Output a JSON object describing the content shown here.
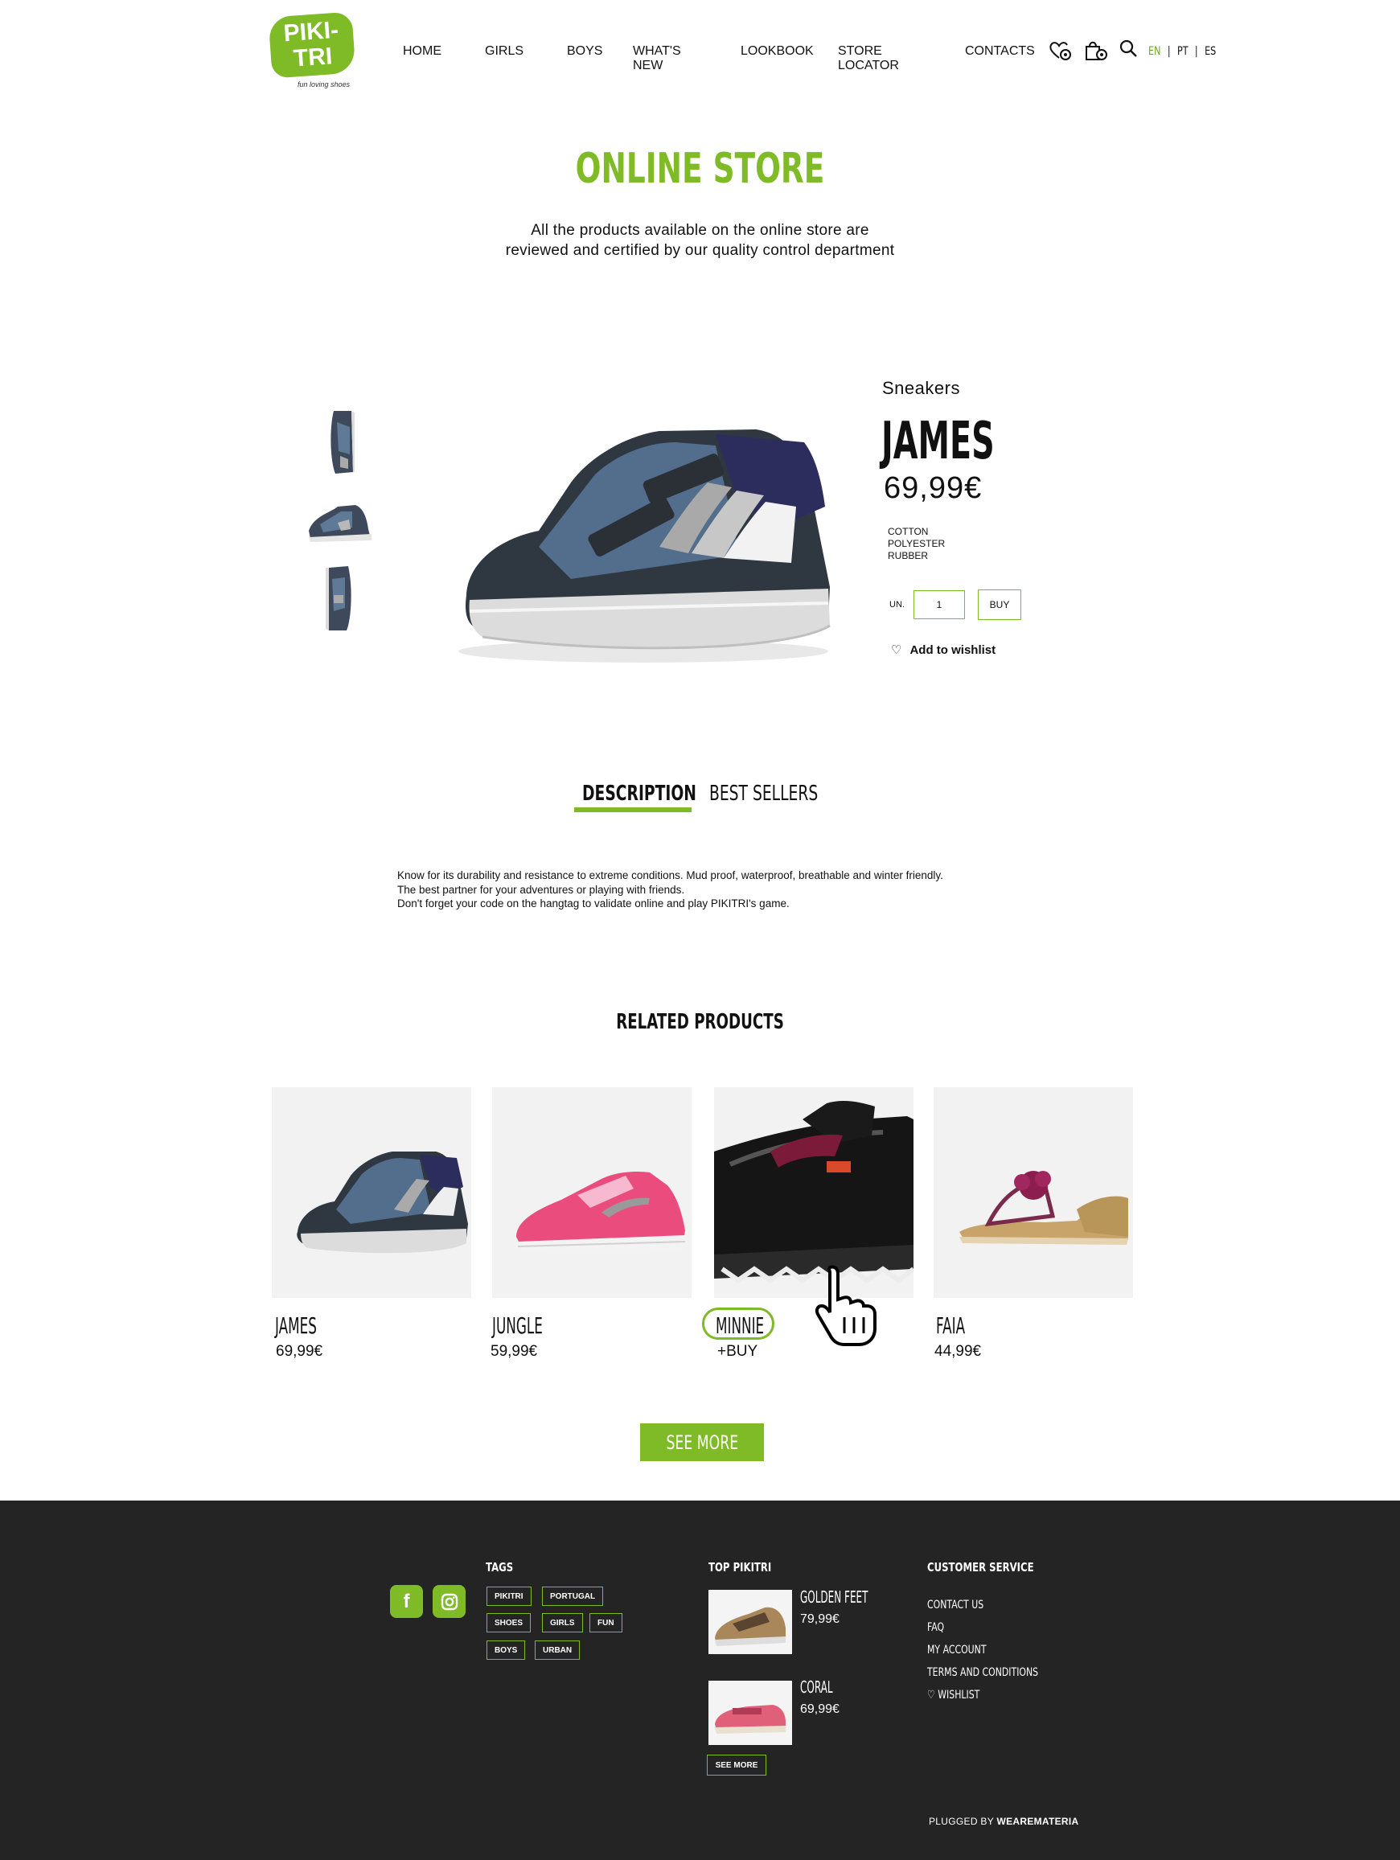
{
  "header": {
    "logo_text": "PIKI-TRI",
    "logo_tagline": "fun loving shoes",
    "nav": [
      "HOME",
      "GIRLS",
      "BOYS",
      "WHAT'S NEW",
      "LOOKBOOK",
      "STORE LOCATOR",
      "CONTACTS"
    ],
    "icons": [
      "wishlist-bag-icon",
      "cart-bag-icon",
      "search-icon"
    ],
    "lang": {
      "active": "EN",
      "others": [
        "PT",
        "ES"
      ],
      "sep": "|"
    }
  },
  "page": {
    "title": "ONLINE STORE",
    "intro_line1": "All the products available on the online store are",
    "intro_line2": "reviewed and certified by our quality control department"
  },
  "product": {
    "category": "Sneakers",
    "name": "JAMES",
    "price": "69,99€",
    "materials": [
      "COTTON",
      "POLYESTER",
      "RUBBER"
    ],
    "qty_label": "UN.",
    "qty_value": "1",
    "buy_label": "BUY",
    "wishlist_label": "Add to wishlist"
  },
  "tabs": {
    "active": "DESCRIPTION",
    "other": "BEST SELLERS"
  },
  "description": [
    "Know for its durability and resistance to extreme conditions. Mud proof, waterproof, breathable and winter friendly.",
    "The best partner for your adventures or playing with friends.",
    "Don't forget your code on the hangtag to validate online and play PIKITRI's game."
  ],
  "related": {
    "title": "RELATED PRODUCTS",
    "items": [
      {
        "name": "JAMES",
        "price": "69,99€"
      },
      {
        "name": "JUNGLE",
        "price": "59,99€"
      },
      {
        "name": "MINNIE",
        "price": "+BUY"
      },
      {
        "name": "FAIA",
        "price": "44,99€"
      }
    ],
    "see_more": "SEE MORE"
  },
  "footer": {
    "tags_title": "TAGS",
    "tags": [
      "PIKITRI",
      "PORTUGAL",
      "SHOES",
      "GIRLS",
      "FUN",
      "BOYS",
      "URBAN"
    ],
    "top_title": "TOP PIKITRI",
    "top_items": [
      {
        "name": "GOLDEN FEET",
        "price": "79,99€"
      },
      {
        "name": "CORAL",
        "price": "69,99€"
      }
    ],
    "top_see_more": "SEE MORE",
    "cs_title": "CUSTOMER SERVICE",
    "cs_links": [
      "CONTACT US",
      "FAQ",
      "MY ACCOUNT",
      "TERMS AND CONDITIONS",
      "♡  WISHLIST"
    ],
    "plugged_by": "PLUGGED BY",
    "plugged_brand": "WEAREMATERIA"
  },
  "colors": {
    "accent": "#7fba27",
    "footer_bg": "#242424",
    "card_bg": "#f2f2f2"
  }
}
